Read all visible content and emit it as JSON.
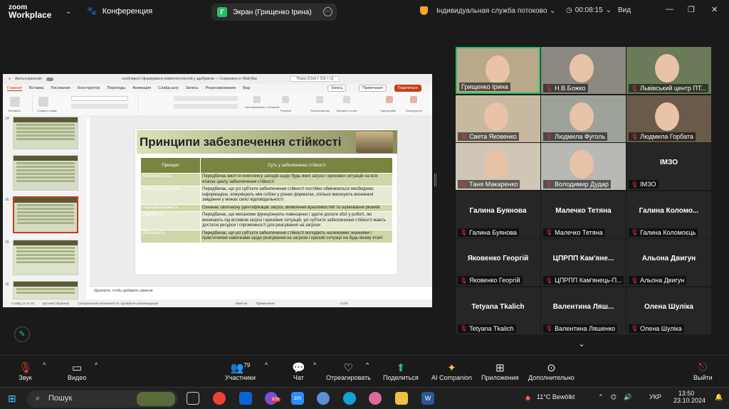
{
  "app": {
    "logo_top": "zoom",
    "logo_bottom": "Workplace"
  },
  "meeting": {
    "title": "Конференция",
    "share_label": "Экран (Грищенко Ірина)",
    "share_badge": "Г"
  },
  "header_right": {
    "service": "Індивидуальная служба потоково...",
    "timer": "00:08:15",
    "view": "Вид"
  },
  "ppt": {
    "autosave": "Автосохранение",
    "filename": "особливості формування компетентностей у здобувачів — Сохранено в: Мой Mac",
    "search": "Поиск (Cmd + Ctrl + U)",
    "tabs": [
      "Главная",
      "Вставка",
      "Рисование",
      "Конструктор",
      "Переходы",
      "Анимация",
      "Слайд-шоу",
      "Запись",
      "Рецензирование",
      "Вид"
    ],
    "record": "Запись",
    "comments": "Примечания",
    "share": "Поделиться",
    "ribbon_labels": [
      "Вставить",
      "Создать слайд",
      "Преобразовать в SmartArt",
      "Рисунок",
      "Расположение",
      "Экспресс-стили",
      "Надстройки",
      "Конструктор"
    ],
    "tooltip": "Преобразовать в рисунок SmartArt",
    "thumb_numbers": [
      "14",
      "",
      "",
      "16",
      "15",
      "16"
    ],
    "notes": "Щелкните, чтобы добавить заметки",
    "status": [
      "Слайд 14 из 18",
      "русский (Украина)",
      "Специальные возможности: проверьте рекомендации",
      "Заметки",
      "Примечания",
      "123%"
    ],
    "slide_title": "Принципи забезпечення стійкості",
    "table_headers": [
      "Принцип",
      "Суть у забезпеченні стійкості"
    ],
    "table_rows": [
      {
        "k": "Комплексність",
        "v": "Передбачає вжиття комплексу заходів щодо будь-яких загроз і кризових ситуацій на всіх етапах циклу забезпечення стійкості"
      },
      {
        "k": "Громадська участь",
        "v": "Передбачає, що усі суб'єкти забезпечення стійкості постійно обмінюються необхідною інформацією, комунікують між собою у різних форматах, спільно виконують визначені завдання у межах своєї відповідальності"
      },
      {
        "k": "Передбачуваність",
        "v": "Означає своєчасну ідентифікацію загроз, виявлення вразливостей та оцінювання ризиків"
      },
      {
        "k": "Надійність",
        "v": "Передбачає, що механізми функціонують повноцінно і здатні долати збої у роботі, які виникають під впливом загроз і кризових ситуацій, усі суб'єкти забезпечення стійкості мають достатні ресурси і спроможності для реагування на загрози"
      },
      {
        "k": "Обізнаність",
        "v": "Передбачає, що усі суб'єкти забезпечення стійкості володіють належними знаннями і практичними навичками щодо реагування на загрози і кризові ситуації на будь-якому етапі"
      }
    ]
  },
  "participants_grid": [
    {
      "name": "Грищенко Ірина",
      "video": true,
      "speaking": true
    },
    {
      "name": "Н.В.Божко",
      "video": true
    },
    {
      "name": "Львівський центр ПТ...",
      "video": true
    },
    {
      "name": "Света Яковенко",
      "video": true
    },
    {
      "name": "Людмила Фуголь",
      "video": true
    },
    {
      "name": "Людмила Горбата",
      "video": true
    },
    {
      "name": "Таня Макаренко",
      "video": true
    },
    {
      "name": "Володимир Дудар",
      "video": true
    },
    {
      "name": "ІМЗО",
      "video": false,
      "big": "ІМЗО"
    },
    {
      "name": "Галина Буянова",
      "video": false,
      "big": "Галина Буянова"
    },
    {
      "name": "Малечко Тетяна",
      "video": false,
      "big": "Малечко Тетяна"
    },
    {
      "name": "Галина Коломоєць",
      "video": false,
      "big": "Галина  Коломо..."
    },
    {
      "name": "Яковенко Георгій",
      "video": false,
      "big": "Яковенко Георгій"
    },
    {
      "name": "ЦПРПП Кам'янець-П...",
      "video": false,
      "big": "ЦПРПП  Кам'яне..."
    },
    {
      "name": "Альона Двигун",
      "video": false,
      "big": "Альона Двигун"
    },
    {
      "name": "Tetyana Tkalich",
      "video": false,
      "big": "Tetyana Tkalich"
    },
    {
      "name": "Валентина Ляшенко",
      "video": false,
      "big": "Валентина  Ляш..."
    },
    {
      "name": "Олена Шуліка",
      "video": false,
      "big": "Олена Шуліка"
    }
  ],
  "toolbar": {
    "audio": "Звук",
    "video": "Видео",
    "participants": "Участники",
    "participants_count": "79",
    "chat": "Чат",
    "react": "Отреагировать",
    "share": "Поделиться",
    "ai": "AI Companion",
    "apps": "Приложения",
    "more": "Дополнительно",
    "leave": "Выйти"
  },
  "taskbar": {
    "search": "Пошук",
    "weather": "11°C  Bewölkt",
    "lang": "УКР",
    "time": "13:50",
    "date": "23.10.2024",
    "mail_badge": "829",
    "weather_badge": "1"
  },
  "colors": {
    "accent_green": "#23c16b",
    "ppt_red": "#c43e1c",
    "slide_olive": "#7b8340",
    "mute_red": "#e53935"
  }
}
